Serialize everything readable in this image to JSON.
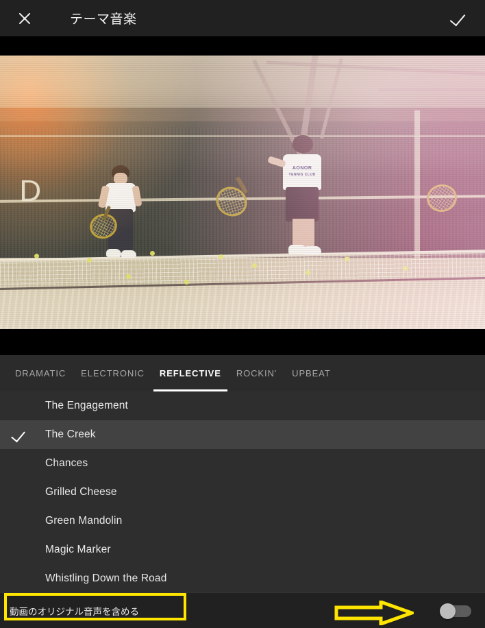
{
  "header": {
    "close_icon": "close-icon",
    "title": "テーマ音楽",
    "confirm_icon": "check-icon"
  },
  "preview": {
    "scene_letter": "D",
    "shirt_logo_line1": "AONOR",
    "shirt_logo_line2": "TENNIS CLUB"
  },
  "tabs": [
    {
      "label": "DRAMATIC",
      "active": false
    },
    {
      "label": "ELECTRONIC",
      "active": false
    },
    {
      "label": "REFLECTIVE",
      "active": true
    },
    {
      "label": "ROCKIN'",
      "active": false
    },
    {
      "label": "UPBEAT",
      "active": false
    }
  ],
  "tracks": [
    {
      "name": "The Engagement",
      "selected": false
    },
    {
      "name": "The Creek",
      "selected": true
    },
    {
      "name": "Chances",
      "selected": false
    },
    {
      "name": "Grilled Cheese",
      "selected": false
    },
    {
      "name": "Green Mandolin",
      "selected": false
    },
    {
      "name": "Magic Marker",
      "selected": false
    },
    {
      "name": "Whistling Down the Road",
      "selected": false
    }
  ],
  "bottom_bar": {
    "original_audio_label": "動画のオリジナル音声を含める",
    "toggle_state": "off"
  },
  "annotation": {
    "color": "#ffe500",
    "highlight_target": "動画のオリジナル音声を含める",
    "arrow_direction": "right",
    "arrow_points_to": "original-audio-toggle"
  }
}
